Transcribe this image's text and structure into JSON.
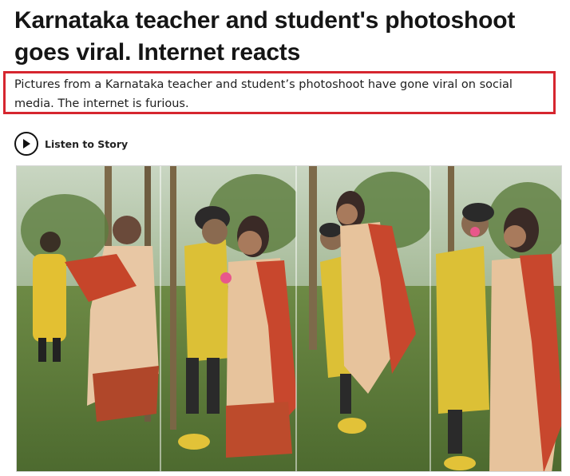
{
  "article": {
    "headline": "Karnataka teacher and student's photoshoot goes viral. Internet reacts",
    "summary": "Pictures from a Karnataka teacher and student’s photoshoot have gone viral on social media. The internet is furious.",
    "listen_label": "Listen to Story",
    "play_icon": "play-circle-icon"
  },
  "colors": {
    "summary_border": "#d6262f",
    "headline": "#151515"
  }
}
